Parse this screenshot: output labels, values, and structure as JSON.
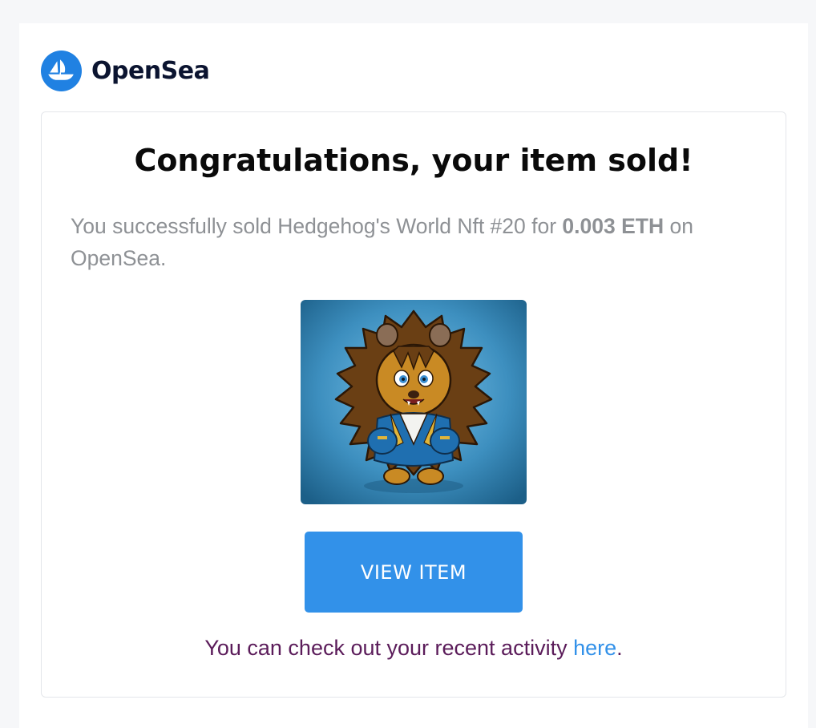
{
  "brand": {
    "name": "OpenSea",
    "logo_icon": "opensea-ship-icon",
    "color": "#2081e2"
  },
  "card": {
    "heading": "Congratulations, your item sold!",
    "message": {
      "before": "You successfully sold Hedgehog's World Nft #20 for ",
      "price": "0.003 ETH",
      "after": " on OpenSea."
    },
    "nft_image": {
      "icon": "hedgehog-nft-image",
      "background": "#3d8fbf"
    },
    "button_label": "VIEW ITEM",
    "activity": {
      "before": "You can check out your recent activity ",
      "link": "here",
      "after": "."
    }
  },
  "colors": {
    "accent": "#3291e9",
    "text_muted": "#8e9195",
    "activity_text": "#5b1c5a"
  }
}
